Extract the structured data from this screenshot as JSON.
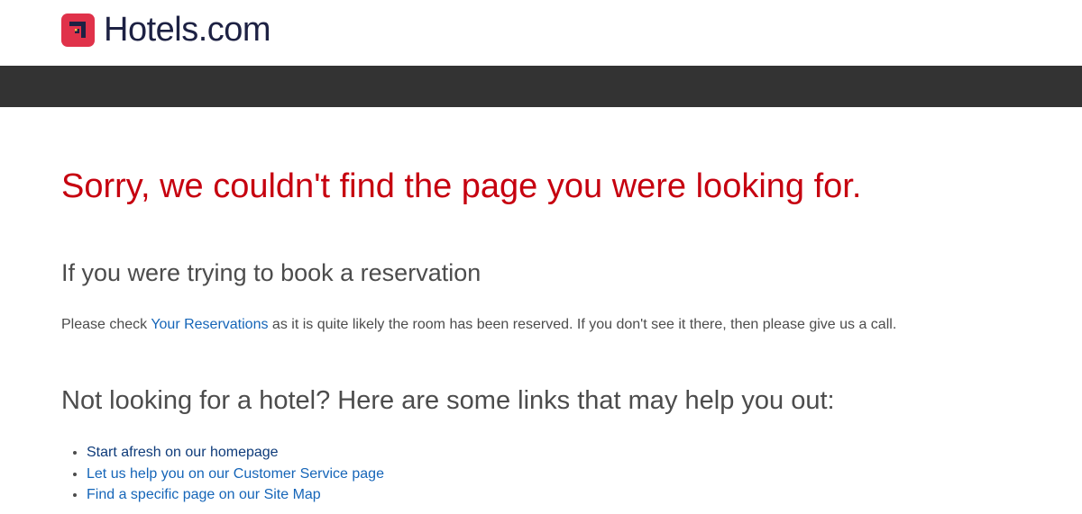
{
  "brand": {
    "name": "Hotels.com",
    "color": "#1d2143",
    "mark_color": "#e0324a"
  },
  "navbar": {
    "color": "#333333"
  },
  "error": {
    "title": "Sorry, we couldn't find the page you were looking for.",
    "color": "#c6000f"
  },
  "reservation": {
    "heading": "If you were trying to book a reservation",
    "text_before": "Please check ",
    "link_label": "Your Reservations",
    "text_after": " as it is quite likely the room has been reserved. If you don't see it there, then please give us a call."
  },
  "help": {
    "heading": "Not looking for a hotel? Here are some links that may help you out:",
    "links": [
      {
        "label": "Start afresh on our homepage"
      },
      {
        "label": "Let us help you on our Customer Service page"
      },
      {
        "label": "Find a specific page on our Site Map"
      }
    ]
  },
  "link_color": "#1565b8"
}
